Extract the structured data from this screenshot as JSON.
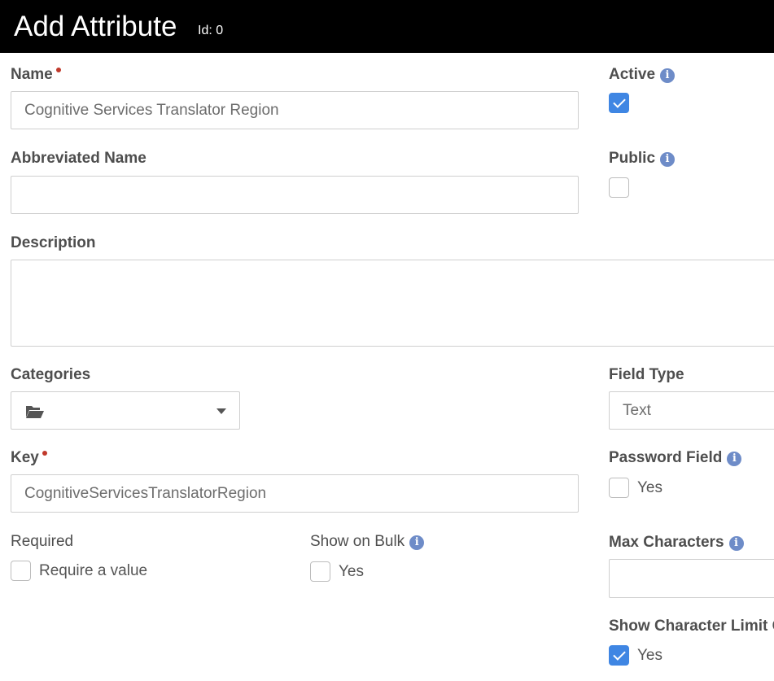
{
  "header": {
    "title": "Add Attribute",
    "id_label": "Id: 0"
  },
  "form": {
    "name": {
      "label": "Name",
      "value": "Cognitive Services Translator Region"
    },
    "active": {
      "label": "Active",
      "checked": true
    },
    "abbreviated_name": {
      "label": "Abbreviated Name",
      "value": ""
    },
    "public": {
      "label": "Public",
      "checked": false
    },
    "description": {
      "label": "Description",
      "value": ""
    },
    "categories": {
      "label": "Categories",
      "value": ""
    },
    "field_type": {
      "label": "Field Type",
      "value": "Text"
    },
    "key": {
      "label": "Key",
      "value": "CognitiveServicesTranslatorRegion"
    },
    "password_field": {
      "label": "Password Field",
      "option": "Yes",
      "checked": false
    },
    "required": {
      "label": "Required",
      "option": "Require a value",
      "checked": false
    },
    "show_on_bulk": {
      "label": "Show on Bulk",
      "option": "Yes",
      "checked": false
    },
    "max_characters": {
      "label": "Max Characters",
      "value": ""
    },
    "show_character_limit": {
      "label": "Show Character Limit C",
      "option": "Yes",
      "checked": true
    }
  },
  "colors": {
    "accent": "#3f86e3",
    "info": "#6e8cc8",
    "required": "#c0392b",
    "header_bg": "#000000"
  },
  "icons": [
    "info-icon",
    "folder-open-icon",
    "chevron-down-icon",
    "check-icon"
  ]
}
